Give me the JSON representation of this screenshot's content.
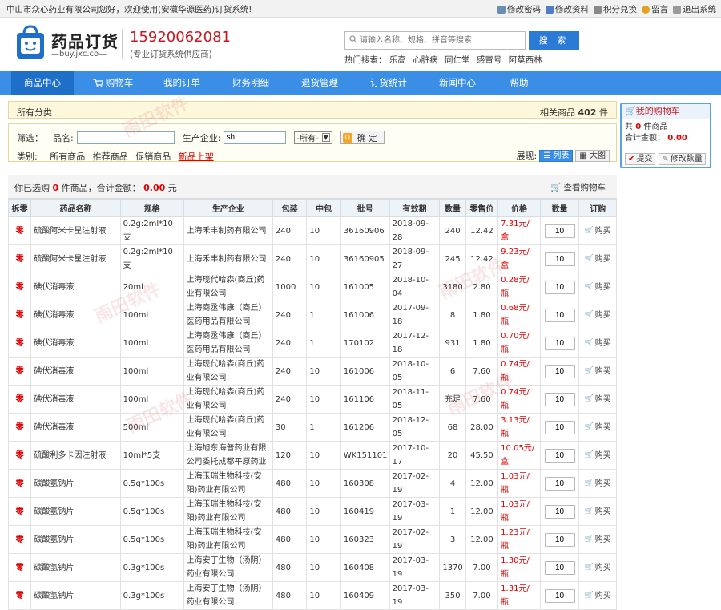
{
  "topbar": {
    "welcome": "中山市众心药业有限公司您好，欢迎使用(安徽华源医药)订货系统!",
    "links": [
      "修改密码",
      "修改资料",
      "积分兑换",
      "留言",
      "退出系统"
    ]
  },
  "header": {
    "brand": "药品订货",
    "brand_sub": "—buy.jxc.co—",
    "phone": "15920062081",
    "phone_sub": "(专业订货系统供应商)",
    "search_placeholder": "请输入名称、规格、拼音等搜索",
    "search_button": "搜 索",
    "hot_label": "热门搜索：",
    "hot_terms": [
      "乐高",
      "心脏病",
      "同仁堂",
      "感冒号",
      "阿莫西林"
    ]
  },
  "nav": {
    "items": [
      "商品中心",
      "购物车",
      "我的订单",
      "财务明细",
      "退货管理",
      "订货统计",
      "新闻中心",
      "帮助"
    ]
  },
  "breadcrumb": {
    "left": "所有分类",
    "right_prefix": "相关商品",
    "count": "402",
    "unit": "件"
  },
  "filter": {
    "label": "筛选：",
    "name_label": "品名:",
    "name_value": "",
    "mfr_label": "生产企业:",
    "mfr_value": "sh",
    "select_value": "-所有-",
    "confirm": "确 定",
    "category_label": "类别:",
    "categories": [
      "所有商品",
      "推荐商品",
      "促销商品",
      "新品上架"
    ],
    "view_label": "展现:",
    "view_list": "列表",
    "view_grid": "大图"
  },
  "cartbar": {
    "prefix": "你已选购",
    "count": "0",
    "mid": "件商品，合计金额：",
    "amount": "0.00",
    "suffix": "元",
    "view_cart": "查看购物车"
  },
  "table": {
    "headers": [
      "拆零",
      "药品名称",
      "规格",
      "生产企业",
      "包装",
      "中包",
      "批号",
      "有效期",
      "数量",
      "零售价",
      "价格",
      "数量",
      "订购"
    ],
    "rows": [
      {
        "z": "零",
        "name": "硫酸阿米卡星注射液",
        "spec": "0.2g:2ml*10支",
        "mfr": "上海禾丰制药有限公司",
        "pack": "240",
        "mid": "10",
        "batch": "36160906",
        "exp": "2018-09-28",
        "qty": "240",
        "retail": "12.42",
        "price": "7.31元/盒",
        "order": "10",
        "buy": "购买"
      },
      {
        "z": "零",
        "name": "硫酸阿米卡星注射液",
        "spec": "0.2g:2ml*10支",
        "mfr": "上海禾丰制药有限公司",
        "pack": "240",
        "mid": "10",
        "batch": "36160905",
        "exp": "2018-09-27",
        "qty": "245",
        "retail": "12.42",
        "price": "9.23元/盒",
        "order": "10",
        "buy": "购买"
      },
      {
        "z": "零",
        "name": "碘伏消毒液",
        "spec": "20ml",
        "mfr": "上海现代哈森(商丘)药业有限公司",
        "pack": "1000",
        "mid": "10",
        "batch": "161005",
        "exp": "2018-10-04",
        "qty": "3180",
        "retail": "2.80",
        "price": "0.28元/瓶",
        "order": "10",
        "buy": "购买"
      },
      {
        "z": "零",
        "name": "碘伏消毒液",
        "spec": "100ml",
        "mfr": "上海商丞伟康（商丘）医药用品有限公司",
        "pack": "240",
        "mid": "1",
        "batch": "161006",
        "exp": "2017-09-18",
        "qty": "8",
        "retail": "1.80",
        "price": "0.68元/瓶",
        "order": "10",
        "buy": "购买"
      },
      {
        "z": "零",
        "name": "碘伏消毒液",
        "spec": "100ml",
        "mfr": "上海商丞伟康（商丘）医药用品有限公司",
        "pack": "240",
        "mid": "1",
        "batch": "170102",
        "exp": "2017-12-18",
        "qty": "931",
        "retail": "1.80",
        "price": "0.70元/瓶",
        "order": "10",
        "buy": "购买"
      },
      {
        "z": "零",
        "name": "碘伏消毒液",
        "spec": "100ml",
        "mfr": "上海现代哈森(商丘)药业有限公司",
        "pack": "240",
        "mid": "10",
        "batch": "161006",
        "exp": "2018-10-05",
        "qty": "6",
        "retail": "7.60",
        "price": "0.74元/瓶",
        "order": "10",
        "buy": "购买"
      },
      {
        "z": "零",
        "name": "碘伏消毒液",
        "spec": "100ml",
        "mfr": "上海现代哈森(商丘)药业有限公司",
        "pack": "240",
        "mid": "10",
        "batch": "161106",
        "exp": "2018-11-05",
        "qty": "充足",
        "retail": "7.60",
        "price": "0.74元/瓶",
        "order": "10",
        "buy": "购买"
      },
      {
        "z": "零",
        "name": "碘伏消毒液",
        "spec": "500ml",
        "mfr": "上海现代哈森(商丘)药业有限公司",
        "pack": "30",
        "mid": "1",
        "batch": "161206",
        "exp": "2018-12-05",
        "qty": "68",
        "retail": "28.00",
        "price": "3.13元/瓶",
        "order": "10",
        "buy": "购买"
      },
      {
        "z": "零",
        "name": "硫酸利多卡因注射液",
        "spec": "10ml*5支",
        "mfr": "上海旭东海普药业有限公司委托成都平原药业",
        "pack": "120",
        "mid": "10",
        "batch": "WK151101",
        "exp": "2017-10-17",
        "qty": "20",
        "retail": "45.50",
        "price": "10.05元/盒",
        "order": "10",
        "buy": "购买"
      },
      {
        "z": "零",
        "name": "碳酸氢钠片",
        "spec": "0.5g*100s",
        "mfr": "上海玉瑞生物科技(安阳)药业有限公司",
        "pack": "480",
        "mid": "10",
        "batch": "160308",
        "exp": "2017-02-19",
        "qty": "4",
        "retail": "12.00",
        "price": "1.03元/瓶",
        "order": "10",
        "buy": "购买"
      },
      {
        "z": "零",
        "name": "碳酸氢钠片",
        "spec": "0.5g*100s",
        "mfr": "上海玉瑞生物科技(安阳)药业有限公司",
        "pack": "480",
        "mid": "10",
        "batch": "160419",
        "exp": "2017-03-19",
        "qty": "1",
        "retail": "12.00",
        "price": "1.03元/瓶",
        "order": "10",
        "buy": "购买"
      },
      {
        "z": "零",
        "name": "碳酸氢钠片",
        "spec": "0.5g*100s",
        "mfr": "上海玉瑞生物科技(安阳)药业有限公司",
        "pack": "480",
        "mid": "10",
        "batch": "160323",
        "exp": "2017-02-19",
        "qty": "3",
        "retail": "12.00",
        "price": "1.23元/瓶",
        "order": "10",
        "buy": "购买"
      },
      {
        "z": "零",
        "name": "碳酸氢钠片",
        "spec": "0.3g*100s",
        "mfr": "上海安丁生物（汤阴）药业有限公司",
        "pack": "480",
        "mid": "10",
        "batch": "160408",
        "exp": "2017-03-19",
        "qty": "1370",
        "retail": "7.00",
        "price": "1.30元/瓶",
        "order": "10",
        "buy": "购买"
      },
      {
        "z": "零",
        "name": "碳酸氢钠片",
        "spec": "0.3g*100s",
        "mfr": "上海安丁生物（汤阴）药业有限公司",
        "pack": "480",
        "mid": "10",
        "batch": "160409",
        "exp": "2017-03-19",
        "qty": "350",
        "retail": "7.00",
        "price": "1.31元/瓶",
        "order": "10",
        "buy": "购买"
      }
    ]
  },
  "sidecart": {
    "title": "我的购物车",
    "line1_a": "共",
    "count": "0",
    "line1_b": "件商品",
    "amount_label": "合计金额：",
    "amount": "0.00",
    "submit": "提交",
    "modify": "修改数量"
  },
  "watermark": "雨田软件",
  "colors": {
    "accent": "#3a8ee6",
    "price_red": "#e40000",
    "brand_red": "#c8161e"
  }
}
